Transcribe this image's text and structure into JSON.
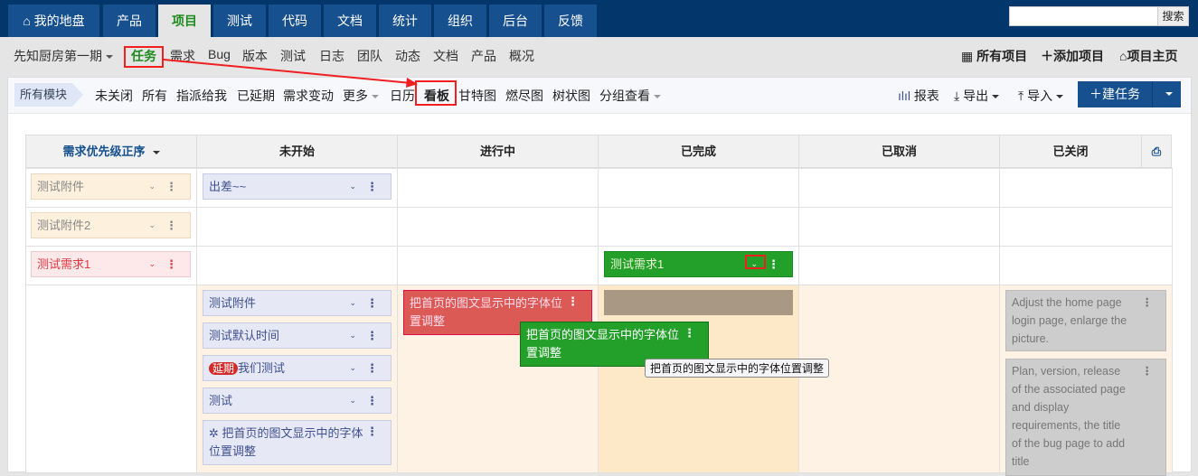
{
  "topnav": {
    "tabs": [
      "我的地盘",
      "产品",
      "项目",
      "测试",
      "代码",
      "文档",
      "统计",
      "组织",
      "后台",
      "反馈"
    ],
    "active": "项目",
    "search_placeholder": "",
    "search_button": "搜索"
  },
  "subnav": {
    "project": "先知厨房第一期",
    "items": [
      "任务",
      "需求",
      "Bug",
      "版本",
      "测试",
      "日志",
      "团队",
      "动态",
      "文档",
      "产品",
      "概况"
    ],
    "active": "任务",
    "right": [
      "所有项目",
      "添加项目",
      "项目主页"
    ]
  },
  "toolbar": {
    "module": "所有模块",
    "items": [
      "未关闭",
      "所有",
      "指派给我",
      "已延期",
      "需求变动",
      "更多",
      "日历",
      "看板",
      "甘特图",
      "燃尽图",
      "树状图",
      "分组查看"
    ],
    "active": "看板",
    "report": "报表",
    "export": "导出",
    "import": "导入",
    "new_task": "建任务"
  },
  "board": {
    "columns": [
      "需求优先级正序",
      "未开始",
      "进行中",
      "已完成",
      "已取消",
      "已关闭"
    ],
    "stories": [
      "测试附件",
      "测试附件2",
      "测试需求1"
    ],
    "cards": {
      "row1_todo": "出差~~",
      "row3_done": "测试需求1",
      "todo": [
        "测试附件",
        "测试默认时间",
        "我们测试",
        "测试",
        "把首页的图文显示中的字体位置调整"
      ],
      "delay_badge": "延期",
      "doing": "把首页的图文显示中的字体位置调整",
      "dragging": "把首页的图文显示中的字体位置调整",
      "tooltip": "把首页的图文显示中的字体位置调整",
      "closed": [
        "Adjust the home page login page, enlarge the picture.",
        "Plan, version, release of the associated page and display requirements, the title of the bug page to add title"
      ]
    }
  },
  "colors": {
    "nav": "#03366a",
    "tab": "#17508e",
    "green": "#23a02a",
    "red": "#dc5a55",
    "annotation": "#f02020"
  }
}
